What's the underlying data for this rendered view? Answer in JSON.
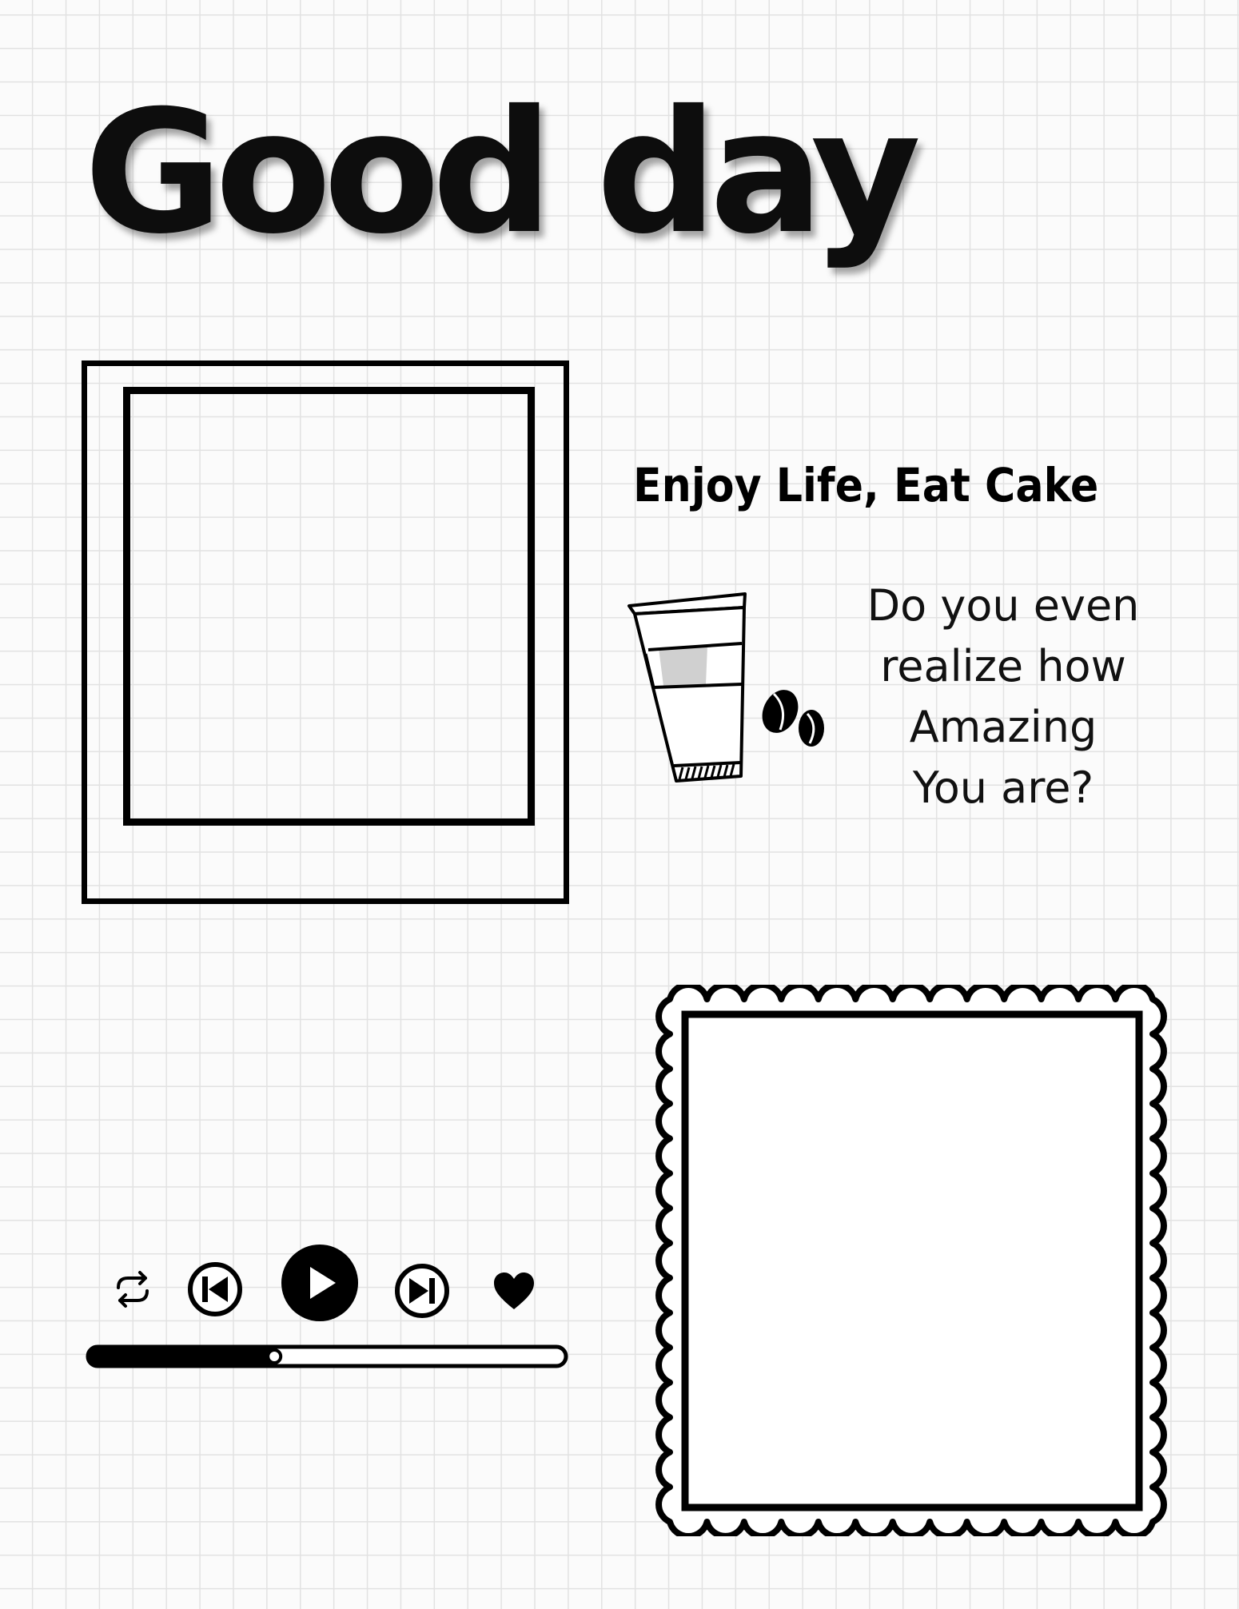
{
  "title": "Good day",
  "subtitle": "Enjoy Life, Eat Cake",
  "quote_lines": [
    "Do you even",
    "realize how",
    "Amazing",
    "You are?"
  ],
  "photo_frame": {
    "style": "polaroid"
  },
  "scalloped_frame": {
    "style": "scalloped"
  },
  "music_player": {
    "controls": [
      "repeat-icon",
      "previous-icon",
      "play-icon",
      "next-icon",
      "heart-icon"
    ],
    "progress": 0.4
  },
  "colors": {
    "ink": "#000000",
    "grid": "#e2e2e2",
    "background": "#fbfbfb",
    "cup_fill": "#d0d0d0"
  }
}
